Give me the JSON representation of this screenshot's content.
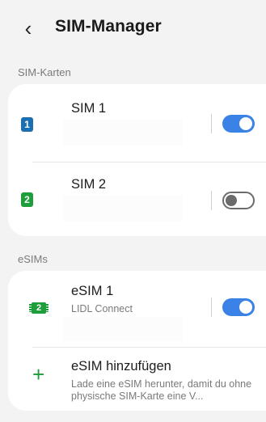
{
  "header": {
    "back_icon": "chevron-left-icon",
    "back_glyph": "‹",
    "title": "SIM-Manager"
  },
  "sim_section": {
    "label": "SIM-Karten",
    "items": [
      {
        "badge": "1",
        "badge_color": "#1b6fb0",
        "title": "SIM 1",
        "enabled": true
      },
      {
        "badge": "2",
        "badge_color": "#1e9e3a",
        "title": "SIM 2",
        "enabled": false
      }
    ]
  },
  "esim_section": {
    "label": "eSIMs",
    "items": [
      {
        "badge": "2",
        "badge_color": "#1e9e3a",
        "title": "eSIM 1",
        "subtitle": "LIDL Connect",
        "enabled": true
      }
    ],
    "add": {
      "icon": "plus-icon",
      "glyph": "+",
      "title": "eSIM hinzufügen",
      "subtitle": "Lade eine eSIM herunter, damit du ohne physische SIM-Karte eine V..."
    }
  },
  "colors": {
    "toggle_on": "#3b82e6",
    "toggle_off_border": "#6b6b6b",
    "background": "#f3f3f3"
  }
}
